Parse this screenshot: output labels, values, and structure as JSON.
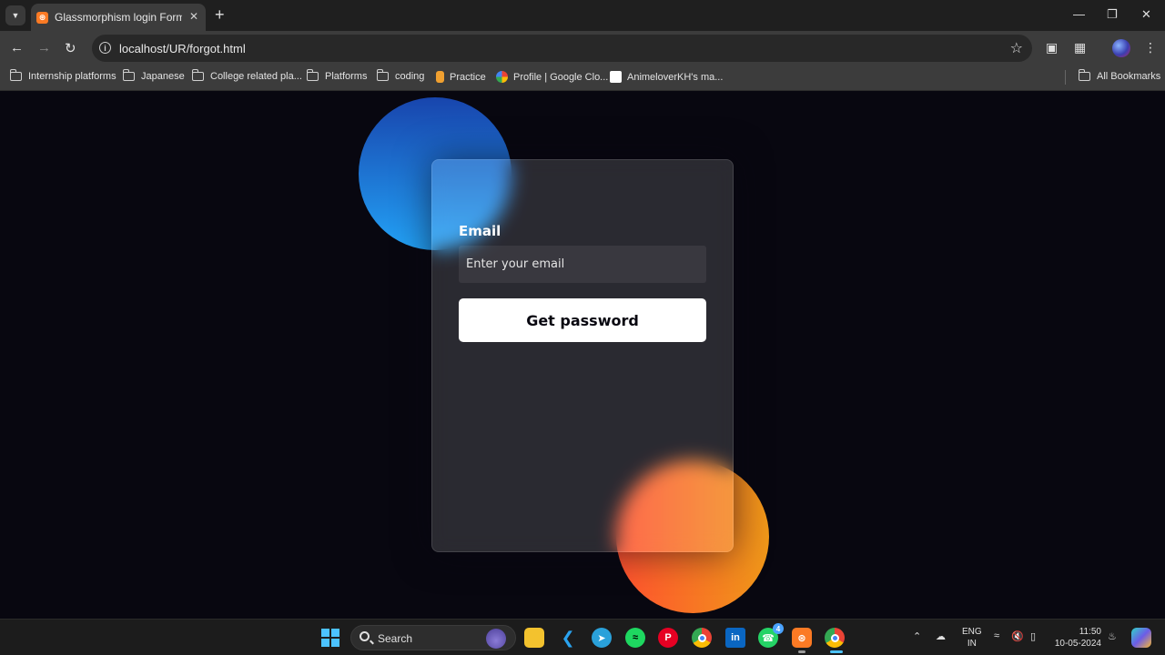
{
  "browser": {
    "tab_title": "Glassmorphism login Form Tuto",
    "url": "localhost/UR/forgot.html",
    "bookmarks": [
      "Internship platforms",
      "Japanese",
      "College related pla...",
      "Platforms",
      "coding",
      "Practice",
      "Profile | Google Clo...",
      "AnimeloverKH's ma..."
    ],
    "all_bookmarks_label": "All Bookmarks"
  },
  "form": {
    "email_label": "Email",
    "email_placeholder": "Enter your email",
    "email_value": "",
    "submit_label": "Get password"
  },
  "colors": {
    "background": "#080710",
    "blue_gradient": [
      "#1845ad",
      "#23a2f6"
    ],
    "orange_gradient": [
      "#ff512f",
      "#f09819"
    ]
  },
  "taskbar": {
    "search_label": "Search",
    "whatsapp_badge": "4",
    "language_line1": "ENG",
    "language_line2": "IN",
    "time": "11:50",
    "date": "10-05-2024"
  }
}
